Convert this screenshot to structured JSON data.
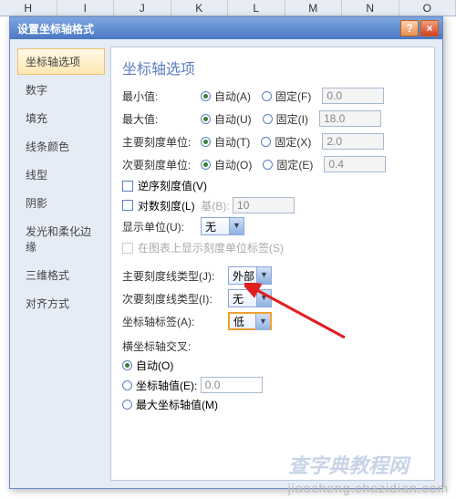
{
  "title": "设置坐标轴格式",
  "side": {
    "items": [
      "坐标轴选项",
      "数字",
      "填充",
      "线条颜色",
      "线型",
      "阴影",
      "发光和柔化边缘",
      "三维格式",
      "对齐方式"
    ]
  },
  "hdr": "坐标轴选项",
  "rows": {
    "min": {
      "lbl": "最小值:",
      "auto": "自动(A)",
      "fixed": "固定(F)",
      "val": "0.0"
    },
    "max": {
      "lbl": "最大值:",
      "auto": "自动(U)",
      "fixed": "固定(I)",
      "val": "18.0"
    },
    "maj": {
      "lbl": "主要刻度单位:",
      "auto": "自动(T)",
      "fixed": "固定(X)",
      "val": "2.0"
    },
    "mnr": {
      "lbl": "次要刻度单位:",
      "auto": "自动(O)",
      "fixed": "固定(E)",
      "val": "0.4"
    }
  },
  "chk1": "逆序刻度值(V)",
  "chk2": {
    "lbl": "对数刻度(L)",
    "baselbl": "基(B):",
    "baseval": "10"
  },
  "disp": {
    "lbl": "显示单位(U):",
    "val": "无"
  },
  "chk3": "在图表上显示刻度单位标签(S)",
  "tick": {
    "major": {
      "lbl": "主要刻度线类型(J):",
      "val": "外部"
    },
    "minor": {
      "lbl": "次要刻度线类型(I):",
      "val": "无"
    },
    "label": {
      "lbl": "坐标轴标签(A):",
      "val": "低"
    }
  },
  "cross": {
    "title": "横坐标轴交叉:",
    "auto": "自动(O)",
    "val": {
      "lbl": "坐标轴值(E):",
      "val": "0.0"
    },
    "max": "最大坐标轴值(M)"
  },
  "wm": "jiaocheng.chazidian.com",
  "wm2": "查字典教程网"
}
